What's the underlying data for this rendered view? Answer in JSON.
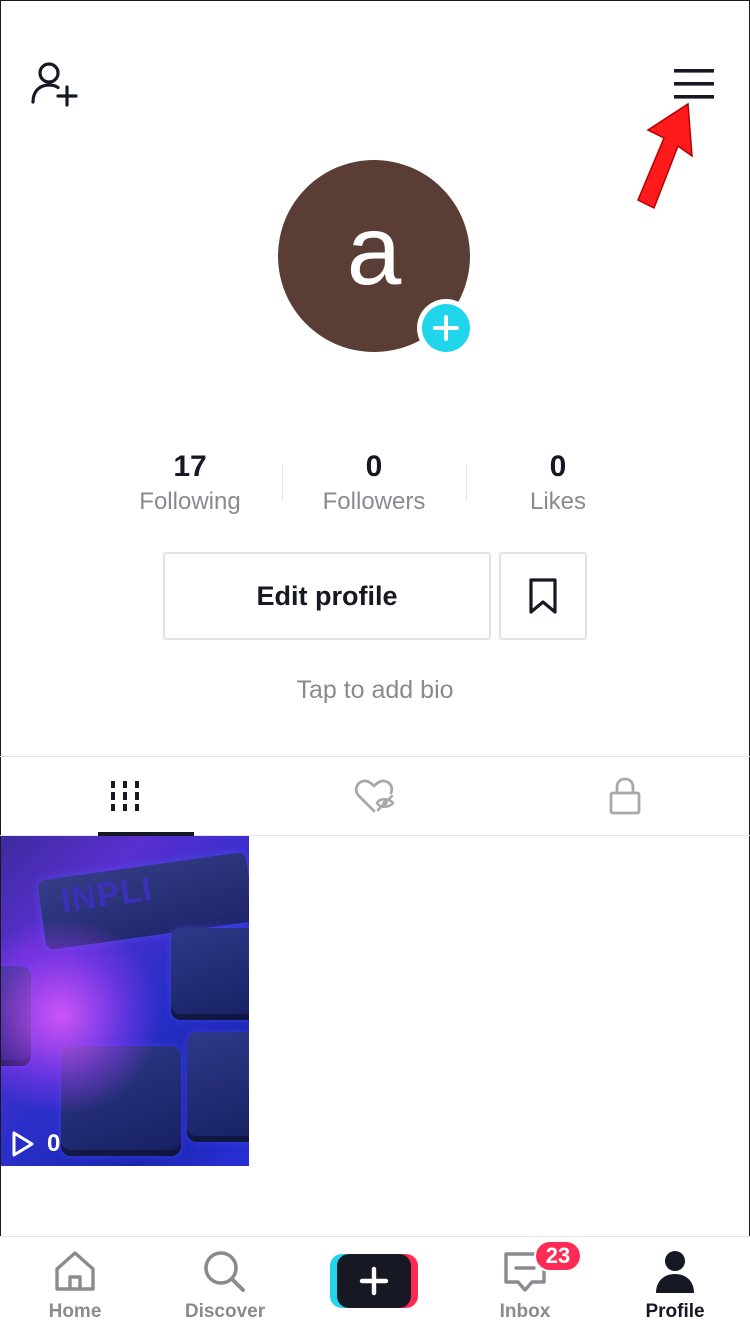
{
  "header": {
    "add_friend_icon": "person-add-icon",
    "menu_icon": "hamburger-menu-icon",
    "annotation": "red-arrow"
  },
  "profile": {
    "avatar_letter": "a",
    "avatar_color": "#5a3e36",
    "add_photo_icon": "plus-icon",
    "add_photo_color": "#20d5ec"
  },
  "stats": [
    {
      "value": "17",
      "label": "Following"
    },
    {
      "value": "0",
      "label": "Followers"
    },
    {
      "value": "0",
      "label": "Likes"
    }
  ],
  "actions": {
    "edit_profile_label": "Edit profile",
    "bookmark_icon": "bookmark-icon"
  },
  "bio": {
    "placeholder": "Tap to add bio"
  },
  "tabs": [
    {
      "icon": "grid-icon",
      "active": true
    },
    {
      "icon": "liked-hidden-icon",
      "active": false
    },
    {
      "icon": "lock-icon",
      "active": false
    }
  ],
  "videos": [
    {
      "play_count": "0",
      "thumb_text": "INPLI"
    }
  ],
  "tabbar": {
    "items": [
      {
        "label": "Home",
        "icon": "home-icon"
      },
      {
        "label": "Discover",
        "icon": "search-icon"
      },
      {
        "label": "",
        "icon": "plus-icon"
      },
      {
        "label": "Inbox",
        "icon": "inbox-icon",
        "badge": "23"
      },
      {
        "label": "Profile",
        "icon": "person-icon",
        "active": true
      }
    ]
  },
  "colors": {
    "accent_red": "#fe2c55",
    "accent_cyan": "#20d5ec",
    "text_primary": "#161823",
    "text_secondary": "#8a8b91"
  }
}
